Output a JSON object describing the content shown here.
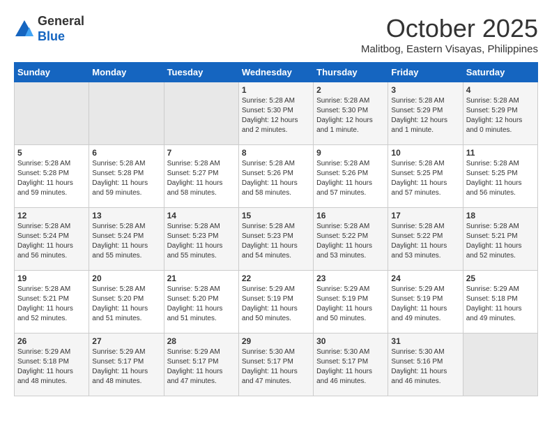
{
  "header": {
    "logo_line1": "General",
    "logo_line2": "Blue",
    "month_year": "October 2025",
    "location": "Malitbog, Eastern Visayas, Philippines"
  },
  "weekdays": [
    "Sunday",
    "Monday",
    "Tuesday",
    "Wednesday",
    "Thursday",
    "Friday",
    "Saturday"
  ],
  "weeks": [
    [
      {
        "day": "",
        "empty": true
      },
      {
        "day": "",
        "empty": true
      },
      {
        "day": "",
        "empty": true
      },
      {
        "day": "1",
        "sunrise": "5:28 AM",
        "sunset": "5:30 PM",
        "daylight": "12 hours and 2 minutes."
      },
      {
        "day": "2",
        "sunrise": "5:28 AM",
        "sunset": "5:30 PM",
        "daylight": "12 hours and 1 minute."
      },
      {
        "day": "3",
        "sunrise": "5:28 AM",
        "sunset": "5:29 PM",
        "daylight": "12 hours and 1 minute."
      },
      {
        "day": "4",
        "sunrise": "5:28 AM",
        "sunset": "5:29 PM",
        "daylight": "12 hours and 0 minutes."
      }
    ],
    [
      {
        "day": "5",
        "sunrise": "5:28 AM",
        "sunset": "5:28 PM",
        "daylight": "11 hours and 59 minutes."
      },
      {
        "day": "6",
        "sunrise": "5:28 AM",
        "sunset": "5:28 PM",
        "daylight": "11 hours and 59 minutes."
      },
      {
        "day": "7",
        "sunrise": "5:28 AM",
        "sunset": "5:27 PM",
        "daylight": "11 hours and 58 minutes."
      },
      {
        "day": "8",
        "sunrise": "5:28 AM",
        "sunset": "5:26 PM",
        "daylight": "11 hours and 58 minutes."
      },
      {
        "day": "9",
        "sunrise": "5:28 AM",
        "sunset": "5:26 PM",
        "daylight": "11 hours and 57 minutes."
      },
      {
        "day": "10",
        "sunrise": "5:28 AM",
        "sunset": "5:25 PM",
        "daylight": "11 hours and 57 minutes."
      },
      {
        "day": "11",
        "sunrise": "5:28 AM",
        "sunset": "5:25 PM",
        "daylight": "11 hours and 56 minutes."
      }
    ],
    [
      {
        "day": "12",
        "sunrise": "5:28 AM",
        "sunset": "5:24 PM",
        "daylight": "11 hours and 56 minutes."
      },
      {
        "day": "13",
        "sunrise": "5:28 AM",
        "sunset": "5:24 PM",
        "daylight": "11 hours and 55 minutes."
      },
      {
        "day": "14",
        "sunrise": "5:28 AM",
        "sunset": "5:23 PM",
        "daylight": "11 hours and 55 minutes."
      },
      {
        "day": "15",
        "sunrise": "5:28 AM",
        "sunset": "5:23 PM",
        "daylight": "11 hours and 54 minutes."
      },
      {
        "day": "16",
        "sunrise": "5:28 AM",
        "sunset": "5:22 PM",
        "daylight": "11 hours and 53 minutes."
      },
      {
        "day": "17",
        "sunrise": "5:28 AM",
        "sunset": "5:22 PM",
        "daylight": "11 hours and 53 minutes."
      },
      {
        "day": "18",
        "sunrise": "5:28 AM",
        "sunset": "5:21 PM",
        "daylight": "11 hours and 52 minutes."
      }
    ],
    [
      {
        "day": "19",
        "sunrise": "5:28 AM",
        "sunset": "5:21 PM",
        "daylight": "11 hours and 52 minutes."
      },
      {
        "day": "20",
        "sunrise": "5:28 AM",
        "sunset": "5:20 PM",
        "daylight": "11 hours and 51 minutes."
      },
      {
        "day": "21",
        "sunrise": "5:28 AM",
        "sunset": "5:20 PM",
        "daylight": "11 hours and 51 minutes."
      },
      {
        "day": "22",
        "sunrise": "5:29 AM",
        "sunset": "5:19 PM",
        "daylight": "11 hours and 50 minutes."
      },
      {
        "day": "23",
        "sunrise": "5:29 AM",
        "sunset": "5:19 PM",
        "daylight": "11 hours and 50 minutes."
      },
      {
        "day": "24",
        "sunrise": "5:29 AM",
        "sunset": "5:19 PM",
        "daylight": "11 hours and 49 minutes."
      },
      {
        "day": "25",
        "sunrise": "5:29 AM",
        "sunset": "5:18 PM",
        "daylight": "11 hours and 49 minutes."
      }
    ],
    [
      {
        "day": "26",
        "sunrise": "5:29 AM",
        "sunset": "5:18 PM",
        "daylight": "11 hours and 48 minutes."
      },
      {
        "day": "27",
        "sunrise": "5:29 AM",
        "sunset": "5:17 PM",
        "daylight": "11 hours and 48 minutes."
      },
      {
        "day": "28",
        "sunrise": "5:29 AM",
        "sunset": "5:17 PM",
        "daylight": "11 hours and 47 minutes."
      },
      {
        "day": "29",
        "sunrise": "5:30 AM",
        "sunset": "5:17 PM",
        "daylight": "11 hours and 47 minutes."
      },
      {
        "day": "30",
        "sunrise": "5:30 AM",
        "sunset": "5:17 PM",
        "daylight": "11 hours and 46 minutes."
      },
      {
        "day": "31",
        "sunrise": "5:30 AM",
        "sunset": "5:16 PM",
        "daylight": "11 hours and 46 minutes."
      },
      {
        "day": "",
        "empty": true
      }
    ]
  ],
  "labels": {
    "sunrise_prefix": "Sunrise: ",
    "sunset_prefix": "Sunset: ",
    "daylight_prefix": "Daylight: "
  }
}
